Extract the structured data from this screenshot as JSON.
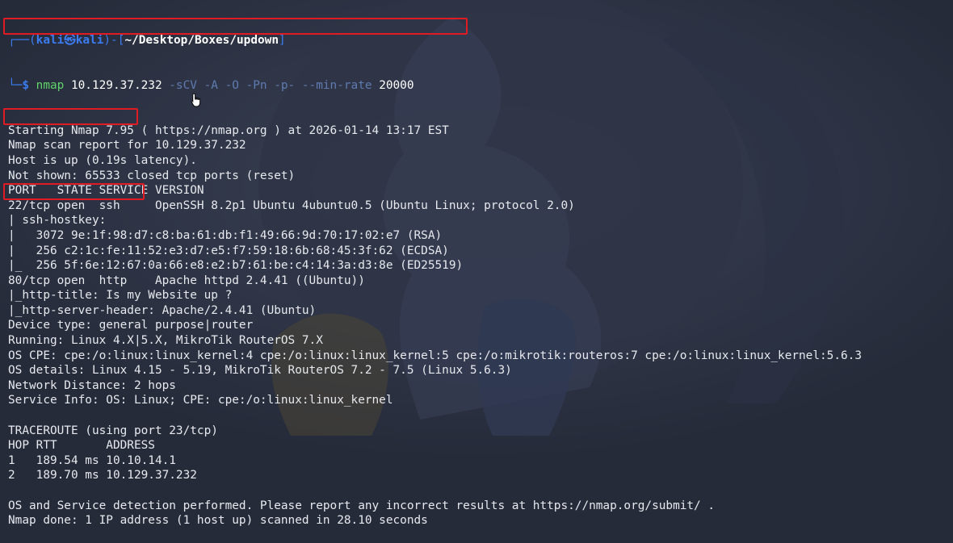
{
  "prompt": {
    "frame_top": "┌──(",
    "user": "kali",
    "at": "㉿",
    "host": "kali",
    "bracket_mid": ")-[",
    "path": "~/Desktop/Boxes/updown",
    "bracket_end": "]",
    "frame_bottom": "└─",
    "dollar": "$ "
  },
  "command": {
    "program": "nmap",
    "target": " 10.129.37.232",
    "options": " -sCV -A -O -Pn -p- --min-rate",
    "rate": " 20000"
  },
  "output": [
    "Starting Nmap 7.95 ( https://nmap.org ) at 2026-01-14 13:17 EST",
    "Nmap scan report for 10.129.37.232",
    "Host is up (0.19s latency).",
    "Not shown: 65533 closed tcp ports (reset)",
    "PORT   STATE SERVICE VERSION",
    "22/tcp open  ssh     OpenSSH 8.2p1 Ubuntu 4ubuntu0.5 (Ubuntu Linux; protocol 2.0)",
    "| ssh-hostkey: ",
    "|   3072 9e:1f:98:d7:c8:ba:61:db:f1:49:66:9d:70:17:02:e7 (RSA)",
    "|   256 c2:1c:fe:11:52:e3:d7:e5:f7:59:18:6b:68:45:3f:62 (ECDSA)",
    "|_  256 5f:6e:12:67:0a:66:e8:e2:b7:61:be:c4:14:3a:d3:8e (ED25519)",
    "80/tcp open  http    Apache httpd 2.4.41 ((Ubuntu))",
    "|_http-title: Is my Website up ?",
    "|_http-server-header: Apache/2.4.41 (Ubuntu)",
    "Device type: general purpose|router",
    "Running: Linux 4.X|5.X, MikroTik RouterOS 7.X",
    "OS CPE: cpe:/o:linux:linux_kernel:4 cpe:/o:linux:linux_kernel:5 cpe:/o:mikrotik:routeros:7 cpe:/o:linux:linux_kernel:5.6.3",
    "OS details: Linux 4.15 - 5.19, MikroTik RouterOS 7.2 - 7.5 (Linux 5.6.3)",
    "Network Distance: 2 hops",
    "Service Info: OS: Linux; CPE: cpe:/o:linux:linux_kernel",
    "",
    "TRACEROUTE (using port 23/tcp)",
    "HOP RTT       ADDRESS",
    "1   189.54 ms 10.10.14.1",
    "2   189.70 ms 10.129.37.232",
    "",
    "OS and Service detection performed. Please report any incorrect results at https://nmap.org/submit/ .",
    "Nmap done: 1 IP address (1 host up) scanned in 28.10 seconds"
  ],
  "colors": {
    "background": "#262b3a",
    "prompt_blue": "#3b7cf0",
    "command_green": "#5fd36a",
    "highlight_red": "#e01b24"
  }
}
